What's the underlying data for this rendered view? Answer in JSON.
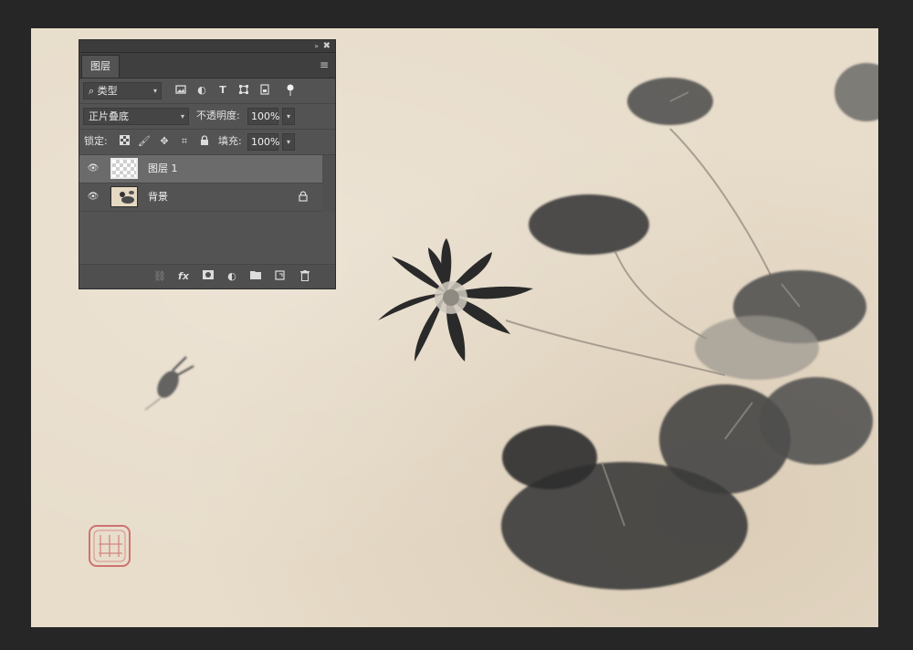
{
  "panel": {
    "tab_label": "图层",
    "filter": {
      "kind": "类型",
      "icon": "search-icon"
    },
    "blend_mode": "正片叠底",
    "opacity_label": "不透明度:",
    "opacity_value": "100%",
    "lock_label": "锁定:",
    "fill_label": "填充:",
    "fill_value": "100%",
    "layers": [
      {
        "name": "图层 1",
        "visible": true,
        "selected": true
      },
      {
        "name": "背景",
        "visible": true,
        "selected": false,
        "locked": true
      }
    ]
  },
  "icons": {
    "collapse": "»",
    "close": "✖",
    "menu": "≡",
    "eye": "👁",
    "lock": "🔒"
  },
  "colors": {
    "panel_bg": "#535353",
    "selected_row": "#6b6b6b",
    "paper": "#e8ddcb",
    "ink": "#2e2e2e",
    "seal_red": "#c9605f"
  }
}
